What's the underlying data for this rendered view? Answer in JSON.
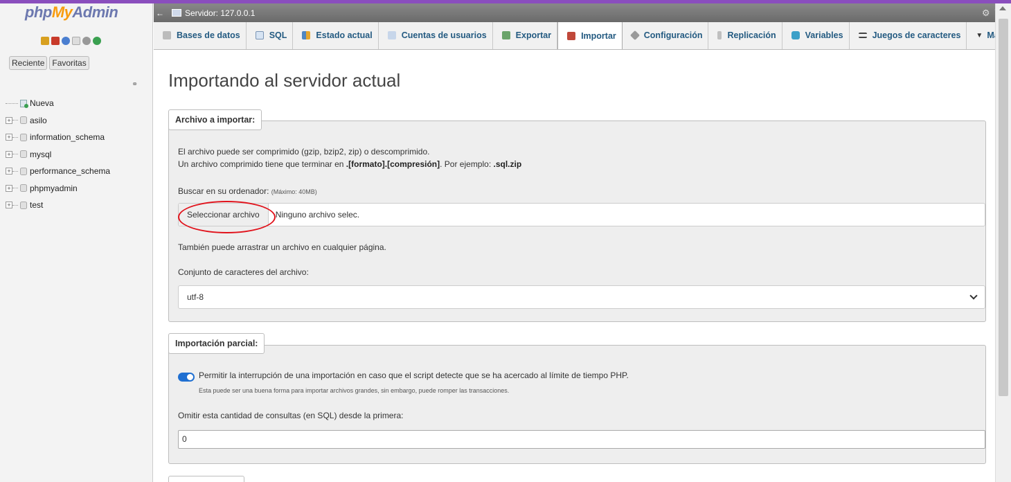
{
  "app": {
    "logo_part1": "php",
    "logo_part2": "My",
    "logo_part3": "Admin"
  },
  "nav": {
    "tabs": [
      "Reciente",
      "Favoritas"
    ],
    "tree": [
      {
        "label": "Nueva",
        "type": "new"
      },
      {
        "label": "asilo",
        "type": "db"
      },
      {
        "label": "information_schema",
        "type": "db"
      },
      {
        "label": "mysql",
        "type": "db"
      },
      {
        "label": "performance_schema",
        "type": "db"
      },
      {
        "label": "phpmyadmin",
        "type": "db"
      },
      {
        "label": "test",
        "type": "db"
      }
    ]
  },
  "server": {
    "label": "Servidor: 127.0.0.1"
  },
  "tabs": [
    {
      "label": "Bases de datos"
    },
    {
      "label": "SQL"
    },
    {
      "label": "Estado actual"
    },
    {
      "label": "Cuentas de usuarios"
    },
    {
      "label": "Exportar"
    },
    {
      "label": "Importar",
      "active": true
    },
    {
      "label": "Configuración"
    },
    {
      "label": "Replicación"
    },
    {
      "label": "Variables"
    },
    {
      "label": "Juegos de caracteres"
    },
    {
      "label": "Más"
    }
  ],
  "page": {
    "title": "Importando al servidor actual",
    "file_section": {
      "legend": "Archivo a importar:",
      "desc1": "El archivo puede ser comprimido (gzip, bzip2, zip) o descomprimido.",
      "desc2_pre": "Un archivo comprimido tiene que terminar en ",
      "desc2_bold": ".[formato].[compresión]",
      "desc2_mid": ". Por ejemplo: ",
      "desc2_bold2": ".sql.zip",
      "browse_label": "Buscar en su ordenador: ",
      "browse_max": "(Máximo: 40MB)",
      "select_button": "Seleccionar archivo",
      "file_status": "Ninguno archivo selec.",
      "drag_hint": "También puede arrastrar un archivo en cualquier página.",
      "charset_label": "Conjunto de caracteres del archivo:",
      "charset_value": "utf-8"
    },
    "partial_section": {
      "legend": "Importación parcial:",
      "toggle_label": "Permitir la interrupción de una importación en caso que el script detecte que se ha acercado al límite de tiempo PHP.",
      "toggle_hint": "Esta puede ser una buena forma para importar archivos grandes, sin embargo, puede romper las transacciones.",
      "toggle_on": true,
      "skip_label": "Omitir esta cantidad de consultas (en SQL) desde la primera:",
      "skip_value": "0"
    }
  },
  "colors": {
    "accent": "#235a81",
    "annotation": "#e1121b",
    "toggle": "#1f6fd1"
  }
}
